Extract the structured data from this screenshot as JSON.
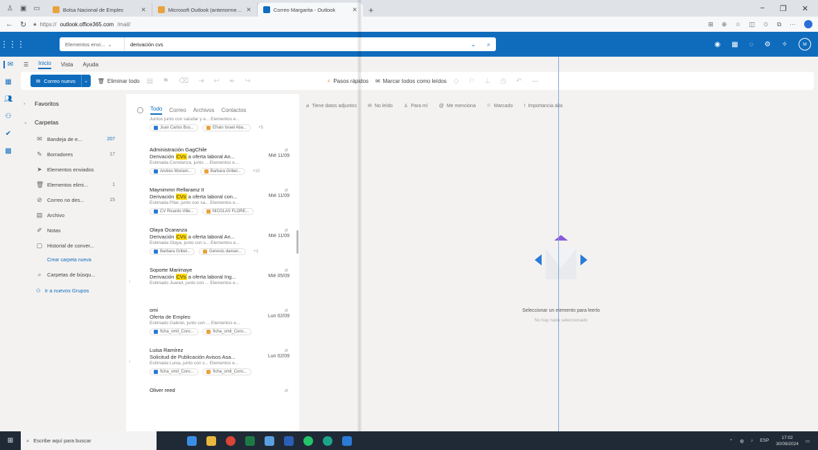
{
  "browser": {
    "tabs": [
      {
        "title": "Bolsa Nacional de Emplec",
        "favicon_color": "#e8a33d"
      },
      {
        "title": "Microsoft Outlook (anteriormente",
        "favicon_color": "#e8a33d"
      },
      {
        "title": "Correo Margarita - Outlook",
        "favicon_color": "#0f6cbd"
      }
    ],
    "url_prefix": "https://",
    "url_domain": "outlook.office365.com",
    "url_path": "/mail/"
  },
  "header": {
    "search_scope": "Elementos envi...",
    "search_query": "derivación cvs",
    "avatar_initials": "M"
  },
  "ribbon_tabs": [
    "Inicio",
    "Vista",
    "Ayuda"
  ],
  "toolbar": {
    "new_mail": "Correo nuevo",
    "delete_all": "Eliminar todo",
    "quick_steps": "Pasos rápidos",
    "mark_all_read": "Marcar todos como leídos"
  },
  "folders": {
    "favorites": "Favoritos",
    "folders_header": "Carpetas",
    "items": [
      {
        "name": "Bandeja de e...",
        "count": "207",
        "icon": "✉"
      },
      {
        "name": "Borradores",
        "count": "17",
        "icon": "✎"
      },
      {
        "name": "Elementos enviados",
        "count": "",
        "icon": "➤"
      },
      {
        "name": "Elementos elimi...",
        "count": "1",
        "icon": "🗑"
      },
      {
        "name": "Correo no des...",
        "count": "15",
        "icon": "⊘"
      },
      {
        "name": "Archivo",
        "count": "",
        "icon": "▤"
      },
      {
        "name": "Notas",
        "count": "",
        "icon": "✐"
      },
      {
        "name": "Historial de conver...",
        "count": "",
        "icon": "▢"
      }
    ],
    "create_folder": "Crear carpeta nueva",
    "search_folders": "Carpetas de búsqu...",
    "groups_link": "Ir a nuevos Grupos"
  },
  "list_tabs": [
    "Todo",
    "Correo",
    "Archivos",
    "Contactos"
  ],
  "messages": [
    {
      "sender": "",
      "subject": "",
      "highlight": "",
      "subject_rest": "",
      "date": "",
      "preview": "Juntos junto con saludar y e...    Elementos e...",
      "attachments": [
        "Juan Carlos Bus...",
        "Efrain Israel Aba..."
      ],
      "more": "+5"
    },
    {
      "sender": "Administración GagChile",
      "subject": "Derivación ",
      "highlight": "CVs",
      "subject_rest": " a oferta laboral An...",
      "date": "Mié 11/09",
      "preview": "Estimada Constanza, junto ...    Elementos e...",
      "attachments": [
        "Andres Moriam...",
        "Barbara Gribel..."
      ],
      "more": "+10"
    },
    {
      "sender": "Maynimmn Rellaramz II",
      "subject": "Derivación ",
      "highlight": "CVs",
      "subject_rest": " a oferta laboral con...",
      "date": "Mié 11/09",
      "preview": "Estimada Pilar, junto con sa...    Elementos e...",
      "attachments": [
        "CV Ricardo Ville...",
        "NICOLAS FLORE..."
      ],
      "more": ""
    },
    {
      "sender": "Olaya Ocaranza",
      "subject": "Derivación ",
      "highlight": "CVs",
      "subject_rest": " a oferta laboral An...",
      "date": "Mié 11/09",
      "preview": "Estimada Olaya, junto con s...    Elementos e...",
      "attachments": [
        "Barbara Gribel...",
        "Genesis daman..."
      ],
      "more": "+1"
    },
    {
      "sender": "Soporte Marimaye",
      "subject": "Derivación ",
      "highlight": "CVs",
      "subject_rest": " a oferta laboral Ing...",
      "date": "Mié 05/09",
      "preview": "Estimado Juanet, junto con ...    Elementos e...",
      "attachments": [],
      "more": ""
    },
    {
      "sender": "omi",
      "subject": "Oferta de Empleo",
      "highlight": "",
      "subject_rest": "",
      "date": "Lun 02/09",
      "preview": "Estimado Gabriel, junto con ...    Elementos e...",
      "attachments": [
        "ficha_omil_Conc...",
        "ficha_omil_Conc..."
      ],
      "more": ""
    },
    {
      "sender": "Luisa Ramírez",
      "subject": "Solicitud de Publicación Avisos Asa...",
      "highlight": "",
      "subject_rest": "",
      "date": "Lun 02/09",
      "preview": "Estimada Luisa, junto con s...    Elementos e...",
      "attachments": [
        "ficha_omil_Conc...",
        "ficha_omil_Conc..."
      ],
      "more": ""
    },
    {
      "sender": "Oliver reed",
      "subject": "",
      "highlight": "",
      "subject_rest": "",
      "date": "",
      "preview": "",
      "attachments": [],
      "more": ""
    }
  ],
  "filters": [
    "Tiene datos adjuntos",
    "No leído",
    "Para mí",
    "Me menciona",
    "Marcado",
    "Importancia alta"
  ],
  "reading_pane": {
    "title": "Seleccionar un elemento para leerlo",
    "subtitle": "No hay nada seleccionado"
  },
  "taskbar": {
    "search_placeholder": "Escribe aquí para buscar",
    "time": "17:02",
    "date": "30/09/2024",
    "lang": "ESP"
  },
  "colors": {
    "accent": "#0f6cbd",
    "highlight": "#ffd800"
  }
}
